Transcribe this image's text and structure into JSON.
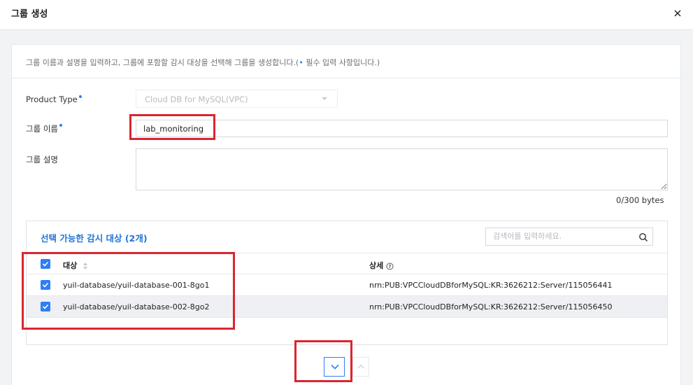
{
  "header": {
    "title": "그룹 생성"
  },
  "form": {
    "description_before": "그룹 이름과 설명을 입력하고, 그룹에 포함할 감시 대상을 선택해 그룹을 생성합니다.(",
    "description_dot": "•",
    "description_after": " 필수 입력 사항입니다.)",
    "product_type_label": "Product Type",
    "product_type_value": "Cloud DB for MySQL(VPC)",
    "group_name_label": "그룹 이름",
    "group_name_value": "lab_monitoring",
    "group_desc_label": "그룹 설명",
    "group_desc_value": "",
    "byte_counter": "0/300 bytes"
  },
  "targets": {
    "title": "선택 가능한 감시 대상 (2개)",
    "search_placeholder": "검색어를 입력하세요.",
    "col_name": "대상",
    "col_detail": "상세",
    "rows": [
      {
        "name": "yuil-database/yuil-database-001-8go1",
        "detail": "nrn:PUB:VPCCloudDBforMySQL:KR:3626212:Server/115056441",
        "checked": true
      },
      {
        "name": "yuil-database/yuil-database-002-8go2",
        "detail": "nrn:PUB:VPCCloudDBforMySQL:KR:3626212:Server/115056450",
        "checked": true
      }
    ]
  },
  "colors": {
    "accent": "#2f7df6",
    "title_blue": "#2174d4",
    "highlight_red": "#d9262f"
  },
  "icons": {
    "close": "close-icon",
    "search": "search-icon",
    "sort": "sort-icon",
    "help": "help-icon",
    "down": "chevron-down-icon",
    "up": "chevron-up-icon"
  }
}
